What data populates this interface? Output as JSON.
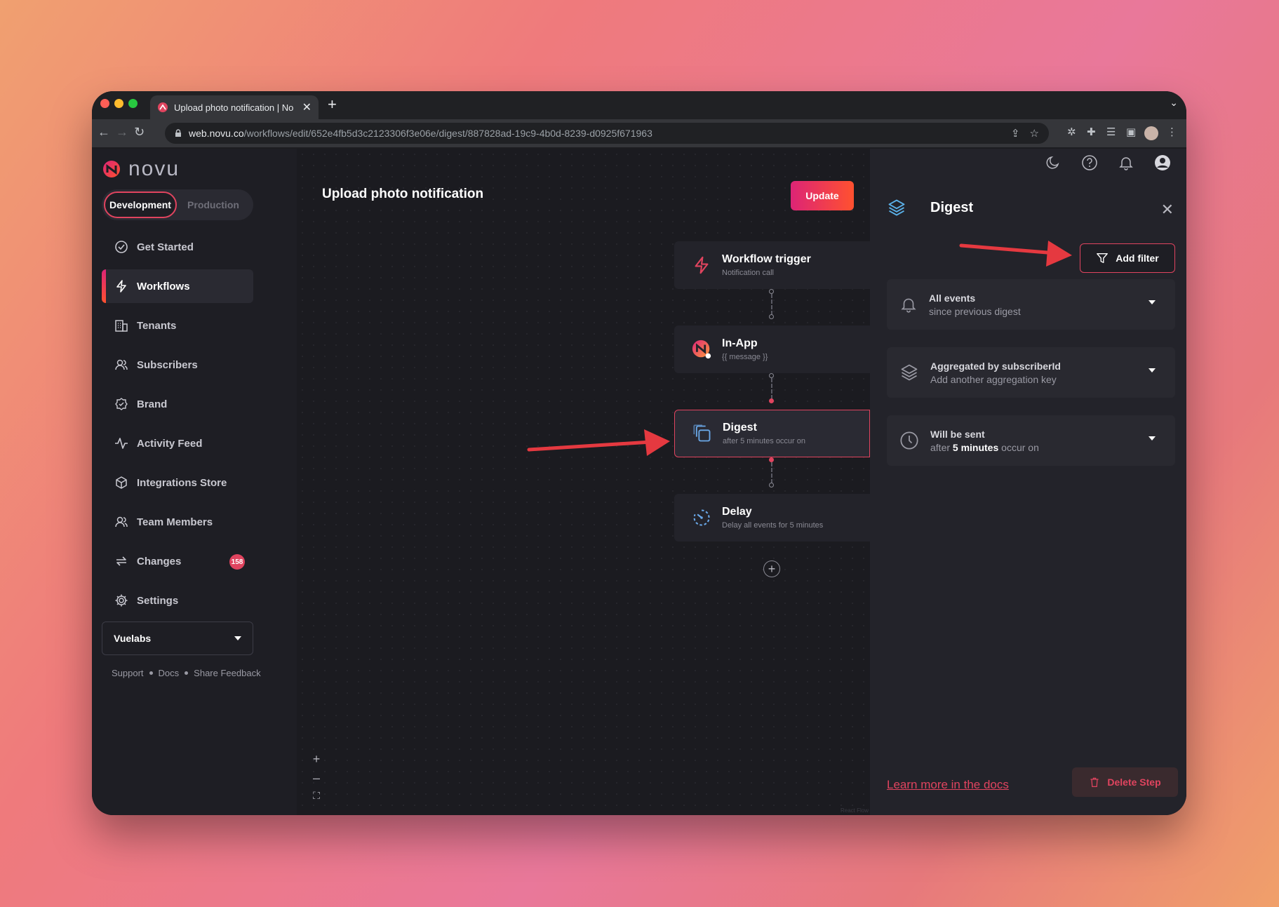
{
  "browser": {
    "tab_title": "Upload photo notification | No",
    "url_host": "web.novu.co",
    "url_path": "/workflows/edit/652e4fb5d3c2123306f3e06e/digest/887828ad-19c9-4b0d-8239-d0925f671963"
  },
  "app": {
    "logo_text": "novu",
    "environments": {
      "active": "Development",
      "inactive": "Production"
    },
    "nav": [
      {
        "label": "Get Started",
        "icon": "check-circle-icon"
      },
      {
        "label": "Workflows",
        "icon": "bolt-icon",
        "active": true
      },
      {
        "label": "Tenants",
        "icon": "building-icon"
      },
      {
        "label": "Subscribers",
        "icon": "users-icon"
      },
      {
        "label": "Brand",
        "icon": "badge-check-icon"
      },
      {
        "label": "Activity Feed",
        "icon": "activity-icon"
      },
      {
        "label": "Integrations Store",
        "icon": "box-icon"
      },
      {
        "label": "Team Members",
        "icon": "team-icon"
      },
      {
        "label": "Changes",
        "icon": "swap-icon",
        "badge": "158"
      },
      {
        "label": "Settings",
        "icon": "gear-icon"
      }
    ],
    "organization": "Vuelabs",
    "footer_links": [
      "Support",
      "Docs",
      "Share Feedback"
    ]
  },
  "canvas": {
    "workflow_title": "Upload photo notification",
    "update_label": "Update",
    "nodes": [
      {
        "title": "Workflow trigger",
        "subtitle": "Notification call"
      },
      {
        "title": "In-App",
        "subtitle": "{{ message }}"
      },
      {
        "title": "Digest",
        "subtitle": "after 5 minutes occur on",
        "selected": true
      },
      {
        "title": "Delay",
        "subtitle": "Delay all events for 5 minutes"
      }
    ],
    "attribution": "React Flow"
  },
  "panel": {
    "title": "Digest",
    "add_filter_label": "Add filter",
    "sections": [
      {
        "title": "All events",
        "subtitle": "since previous digest"
      },
      {
        "title": "Aggregated by subscriberId",
        "subtitle": "Add another aggregation key"
      },
      {
        "title": "Will be sent",
        "subtitle_pre": "after ",
        "subtitle_bold": "5 minutes",
        "subtitle_post": " occur on"
      }
    ],
    "learn_more": "Learn more in the docs",
    "delete_label": "Delete Step"
  },
  "colors": {
    "accent": "#e0445f",
    "sidebar_bg": "#1e1e24",
    "panel_bg": "#23232a",
    "arrow": "#e53940"
  }
}
